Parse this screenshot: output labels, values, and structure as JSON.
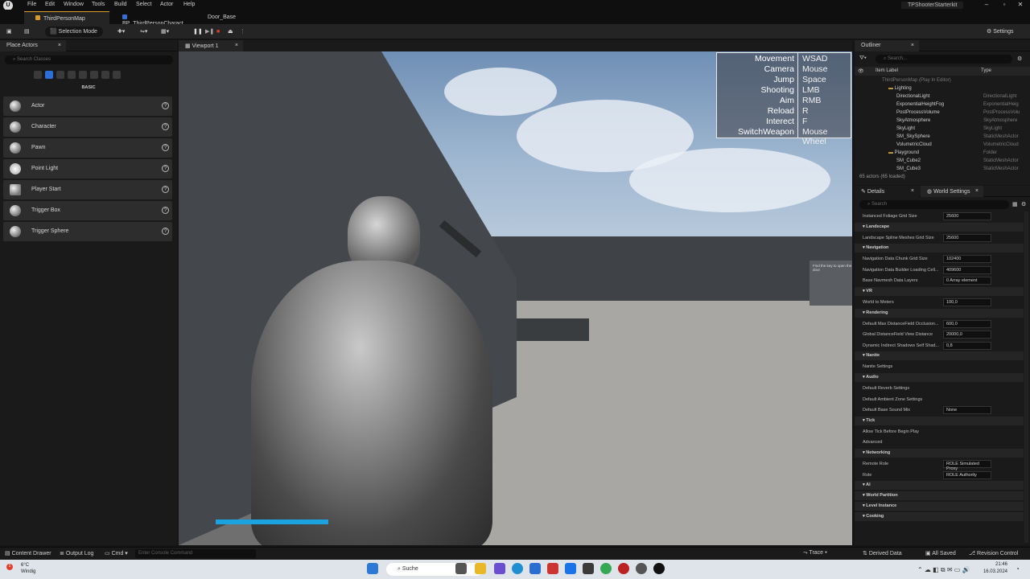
{
  "menubar": {
    "items": [
      "File",
      "Edit",
      "Window",
      "Tools",
      "Build",
      "Select",
      "Actor",
      "Help"
    ],
    "project": "TPShooterStarterkit"
  },
  "tabs": [
    "ThirdPersonMap",
    "BP_ThirdPersonCharact...",
    "Door_Base"
  ],
  "toolbar": {
    "mode": "Selection Mode",
    "settings": "Settings"
  },
  "place_actors": {
    "title": "Place Actors",
    "search_placeholder": "Search Classes",
    "category": "BASIC",
    "items": [
      "Actor",
      "Character",
      "Pawn",
      "Point Light",
      "Player Start",
      "Trigger Box",
      "Trigger Sphere"
    ]
  },
  "viewport": {
    "title": "Viewport 1",
    "controls": [
      {
        "action": "Movement",
        "key": "WSAD"
      },
      {
        "action": "Camera",
        "key": "Mouse"
      },
      {
        "action": "Jump",
        "key": "Space"
      },
      {
        "action": "Shooting",
        "key": "LMB"
      },
      {
        "action": "Aim",
        "key": "RMB"
      },
      {
        "action": "Reload",
        "key": "R"
      },
      {
        "action": "Interect",
        "key": "F"
      },
      {
        "action": "SwitchWeapon",
        "key": "Mouse Wheel"
      }
    ],
    "sign_text": "Find the key to open the door",
    "health_fraction": 1.0
  },
  "outliner": {
    "title": "Outliner",
    "search_placeholder": "Search...",
    "col_label": "Item Label",
    "col_type": "Type",
    "rows": [
      {
        "name": "ThirdPersonMap (Play In Editor)",
        "type": ""
      },
      {
        "name": "Lighting",
        "type": ""
      },
      {
        "name": "DirectionalLight",
        "type": "DirectionalLight"
      },
      {
        "name": "ExponentialHeightFog",
        "type": "ExponentialHeig"
      },
      {
        "name": "PostProcessVolume",
        "type": "PostProcessVolu"
      },
      {
        "name": "SkyAtmosphere",
        "type": "SkyAtmosphere"
      },
      {
        "name": "SkyLight",
        "type": "SkyLight"
      },
      {
        "name": "SM_SkySphere",
        "type": "StaticMeshActor"
      },
      {
        "name": "VolumetricCloud",
        "type": "VolumetricCloud"
      },
      {
        "name": "Playground",
        "type": "Folder"
      },
      {
        "name": "SM_Cube2",
        "type": "StaticMeshActor"
      },
      {
        "name": "SM_Cube3",
        "type": "StaticMeshActor"
      }
    ],
    "count": "65 actors (65 loaded)"
  },
  "details": {
    "tab1": "Details",
    "tab2": "World Settings",
    "search_placeholder": "Search",
    "rows": [
      {
        "kind": "row",
        "label": "Instanced Foliage Grid Size",
        "value": "25600"
      },
      {
        "kind": "section",
        "label": "Landscape"
      },
      {
        "kind": "row",
        "label": "Landscape Spline Meshes Grid Size",
        "value": "25600"
      },
      {
        "kind": "section",
        "label": "Navigation"
      },
      {
        "kind": "row",
        "label": "Navigation Data Chunk Grid Size",
        "value": "102400"
      },
      {
        "kind": "row",
        "label": "Navigation Data Builder Loading Cell...",
        "value": "409600"
      },
      {
        "kind": "row",
        "label": "Base Navmesh Data Layers",
        "value": "0 Array element"
      },
      {
        "kind": "section",
        "label": "VR"
      },
      {
        "kind": "row",
        "label": "World to Meters",
        "value": "100,0"
      },
      {
        "kind": "section",
        "label": "Rendering"
      },
      {
        "kind": "row",
        "label": "Default Max DistanceField Occlusion...",
        "value": "600,0"
      },
      {
        "kind": "row",
        "label": "Global DistanceField View Distance",
        "value": "20000,0"
      },
      {
        "kind": "row",
        "label": "Dynamic Indirect Shadows Self Shad...",
        "value": "0,8"
      },
      {
        "kind": "section",
        "label": "Nanite"
      },
      {
        "kind": "row",
        "label": "Nanite Settings",
        "value": ""
      },
      {
        "kind": "section",
        "label": "Audio"
      },
      {
        "kind": "row",
        "label": "Default Reverb Settings",
        "value": ""
      },
      {
        "kind": "row",
        "label": "Default Ambient Zone Settings",
        "value": ""
      },
      {
        "kind": "row",
        "label": "Default Base Sound Mix",
        "value": "None"
      },
      {
        "kind": "section",
        "label": "Tick"
      },
      {
        "kind": "row",
        "label": "Allow Tick Before Begin Play",
        "value": ""
      },
      {
        "kind": "row",
        "label": "Advanced",
        "value": ""
      },
      {
        "kind": "section",
        "label": "Networking"
      },
      {
        "kind": "row",
        "label": "Remote Role",
        "value": "ROLE Simulated Proxy"
      },
      {
        "kind": "row",
        "label": "Role",
        "value": "ROLE Authority"
      },
      {
        "kind": "section",
        "label": "AI"
      },
      {
        "kind": "section",
        "label": "World Partition"
      },
      {
        "kind": "section",
        "label": "Level Instance"
      },
      {
        "kind": "section",
        "label": "Cooking"
      }
    ]
  },
  "statusbar": {
    "content_drawer": "Content Drawer",
    "output_log": "Output Log",
    "cmd": "Cmd",
    "console_placeholder": "Enter Console Command",
    "trace": "Trace",
    "derived_data": "Derived Data",
    "all_saved": "All Saved",
    "revision": "Revision Control"
  },
  "taskbar": {
    "weather_temp": "6°C",
    "weather_desc": "Windig",
    "search": "Suche",
    "time": "21:46",
    "date": "16.03.2024"
  },
  "colors": {
    "accent": "#d69b2a",
    "health": "#1aa3e0"
  }
}
